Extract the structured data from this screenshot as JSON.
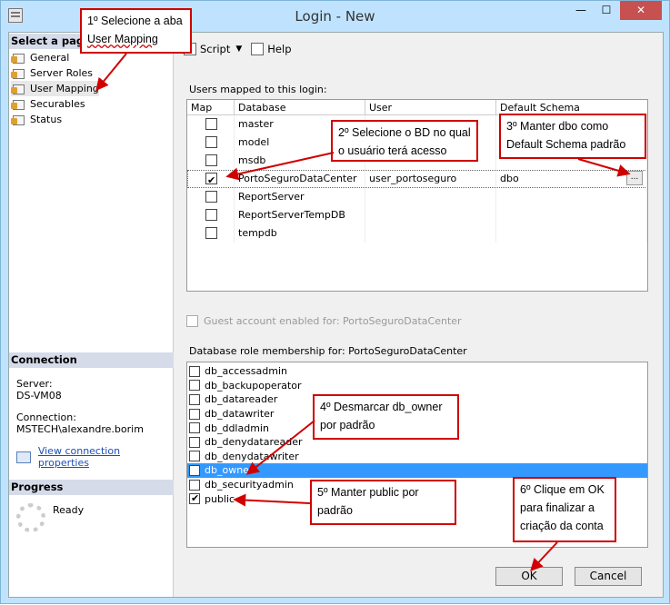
{
  "window": {
    "title": "Login - New",
    "minimize": "—",
    "maximize": "☐",
    "close": "✕"
  },
  "left_pane": {
    "select_page_header": "Select a page",
    "pages": [
      {
        "label": "General"
      },
      {
        "label": "Server Roles"
      },
      {
        "label": "User Mapping"
      },
      {
        "label": "Securables"
      },
      {
        "label": "Status"
      }
    ],
    "connection_header": "Connection",
    "server_label": "Server:",
    "server_value": "DS-VM08",
    "connection_label": "Connection:",
    "connection_value": "MSTECH\\alexandre.borim",
    "view_props_link": "View connection properties",
    "progress_header": "Progress",
    "progress_status": "Ready"
  },
  "toolbar": {
    "script_label": "Script",
    "help_label": "Help"
  },
  "users_mapped": {
    "label": "Users mapped to this login:",
    "columns": [
      "Map",
      "Database",
      "User",
      "Default Schema"
    ],
    "rows": [
      {
        "map": false,
        "database": "master",
        "user": "",
        "schema": ""
      },
      {
        "map": false,
        "database": "model",
        "user": "",
        "schema": ""
      },
      {
        "map": false,
        "database": "msdb",
        "user": "",
        "schema": ""
      },
      {
        "map": true,
        "database": "PortoSeguroDataCenter",
        "user": "user_portoseguro",
        "schema": "dbo"
      },
      {
        "map": false,
        "database": "ReportServer",
        "user": "",
        "schema": ""
      },
      {
        "map": false,
        "database": "ReportServerTempDB",
        "user": "",
        "schema": ""
      },
      {
        "map": false,
        "database": "tempdb",
        "user": "",
        "schema": ""
      }
    ],
    "ellipsis": "..."
  },
  "guest_account": "Guest account enabled for: PortoSeguroDataCenter",
  "role_membership": {
    "label": "Database role membership for: PortoSeguroDataCenter",
    "roles": [
      {
        "name": "db_accessadmin",
        "checked": false
      },
      {
        "name": "db_backupoperator",
        "checked": false
      },
      {
        "name": "db_datareader",
        "checked": false
      },
      {
        "name": "db_datawriter",
        "checked": false
      },
      {
        "name": "db_ddladmin",
        "checked": false
      },
      {
        "name": "db_denydatareader",
        "checked": false
      },
      {
        "name": "db_denydatawriter",
        "checked": false
      },
      {
        "name": "db_owner",
        "checked": false
      },
      {
        "name": "db_securityadmin",
        "checked": false
      },
      {
        "name": "public",
        "checked": true
      }
    ]
  },
  "buttons": {
    "ok": "OK",
    "cancel": "Cancel"
  },
  "annotations": {
    "note1_line1": "1º Selecione a aba",
    "note1_line2": "User Mapping",
    "note2_line1": "2º Selecione o BD no qual",
    "note2_line2": "o usuário terá acesso",
    "note3_line1": "3º Manter dbo como",
    "note3_line2": "Default Schema padrão",
    "note4_line1": "4º Desmarcar db_owner",
    "note4_line2": "por padrão",
    "note5_line1": "5º Manter public por",
    "note5_line2": "padrão",
    "note6_line1": "6º Clique em OK",
    "note6_line2": "para finalizar a",
    "note6_line3": "criação da conta"
  },
  "colors": {
    "annotation_border": "#d00000",
    "selection": "#3399ff",
    "title_bar": "#bfe3ff"
  }
}
